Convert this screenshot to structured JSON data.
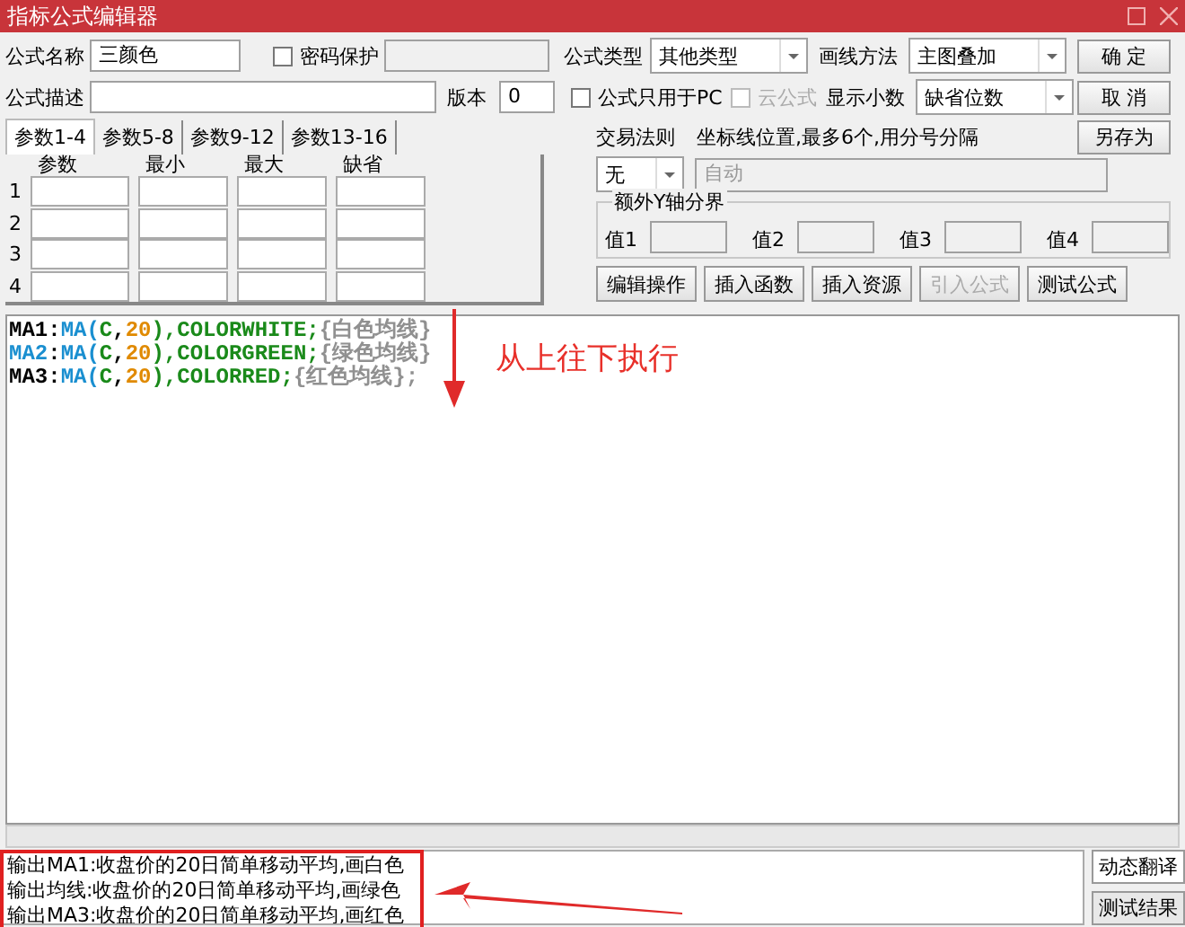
{
  "window": {
    "title": "指标公式编辑器"
  },
  "form": {
    "name": {
      "label": "公式名称",
      "value": "三颜色"
    },
    "password": {
      "label": "密码保护",
      "checked": false
    },
    "type": {
      "label": "公式类型",
      "value": "其他类型"
    },
    "draw": {
      "label": "画线方法",
      "value": "主图叠加"
    },
    "desc": {
      "label": "公式描述"
    },
    "version": {
      "label": "版本",
      "value": "0"
    },
    "pc_only": {
      "label": "公式只用于PC",
      "checked": false
    },
    "cloud": {
      "label": "云公式",
      "checked": false,
      "disabled": true
    },
    "decimals": {
      "label": "显示小数",
      "value": "缺省位数"
    },
    "trade_rule": {
      "label": "交易法则",
      "value": "无"
    },
    "axis_lines": {
      "label": "坐标线位置,最多6个,用分号分隔",
      "placeholder": "自动"
    },
    "y_bounds": {
      "label": "额外Y轴分界",
      "values": [
        {
          "label": "值1"
        },
        {
          "label": "值2"
        },
        {
          "label": "值3"
        },
        {
          "label": "值4"
        }
      ]
    }
  },
  "side_buttons": [
    {
      "label": "确  定"
    },
    {
      "label": "取  消"
    },
    {
      "label": "另存为"
    }
  ],
  "tabs": [
    {
      "label": "参数1-4",
      "selected": true
    },
    {
      "label": "参数5-8",
      "selected": false
    },
    {
      "label": "参数9-12",
      "selected": false
    },
    {
      "label": "参数13-16",
      "selected": false
    }
  ],
  "param_columns": [
    "参数",
    "最小",
    "最大",
    "缺省"
  ],
  "param_rows": [
    "1",
    "2",
    "3",
    "4"
  ],
  "tool_buttons": [
    {
      "label": "编辑操作",
      "disabled": false
    },
    {
      "label": "插入函数",
      "disabled": false
    },
    {
      "label": "插入资源",
      "disabled": false
    },
    {
      "label": "引入公式",
      "disabled": true
    },
    {
      "label": "测试公式",
      "disabled": false
    }
  ],
  "code": [
    [
      {
        "t": "MA1",
        "color": "#000000"
      },
      {
        "t": ":",
        "color": "#000000"
      },
      {
        "t": "MA(",
        "color": "#1a8fd0"
      },
      {
        "t": "C",
        "color": "#1a8a1a"
      },
      {
        "t": ",",
        "color": "#000000"
      },
      {
        "t": "20",
        "color": "#e08a00"
      },
      {
        "t": "),COLORWHITE;",
        "color": "#1a8a1a"
      },
      {
        "t": "{白色均线}",
        "color": "#909090"
      }
    ],
    [
      {
        "t": "MA2",
        "color": "#1a8fd0"
      },
      {
        "t": ":",
        "color": "#000000"
      },
      {
        "t": "MA(",
        "color": "#1a8fd0"
      },
      {
        "t": "C",
        "color": "#1a8a1a"
      },
      {
        "t": ",",
        "color": "#000000"
      },
      {
        "t": "20",
        "color": "#e08a00"
      },
      {
        "t": "),COLORGREEN;",
        "color": "#1a8a1a"
      },
      {
        "t": "{绿色均线}",
        "color": "#909090"
      }
    ],
    [
      {
        "t": "MA3",
        "color": "#000000"
      },
      {
        "t": ":",
        "color": "#000000"
      },
      {
        "t": "MA(",
        "color": "#1a8fd0"
      },
      {
        "t": "C",
        "color": "#1a8a1a"
      },
      {
        "t": ",",
        "color": "#000000"
      },
      {
        "t": "20",
        "color": "#e08a00"
      },
      {
        "t": "),COLORRED;",
        "color": "#1a8a1a"
      },
      {
        "t": "{红色均线};",
        "color": "#909090"
      }
    ]
  ],
  "annotation": "从上往下执行",
  "output_lines": [
    "输出MA1:收盘价的20日简单移动平均,画白色",
    "输出均线:收盘价的20日简单移动平均,画绿色",
    "输出MA3:收盘价的20日简单移动平均,画红色"
  ],
  "output_tabs": [
    {
      "label": "动态翻译",
      "selected": true
    },
    {
      "label": "测试结果",
      "selected": false
    }
  ]
}
